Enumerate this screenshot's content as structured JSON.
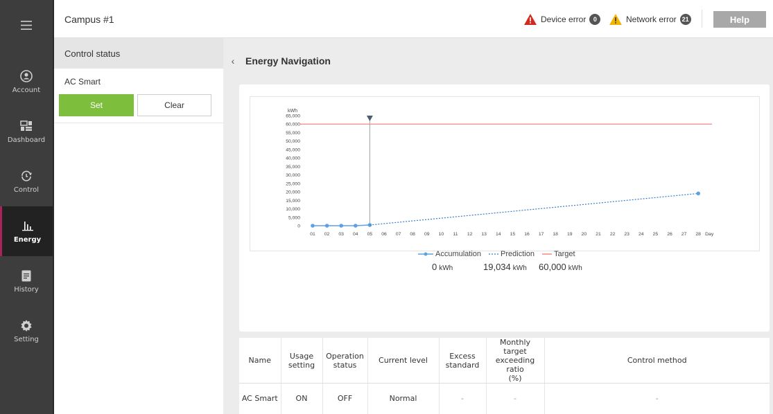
{
  "nav": {
    "menu_icon": "hamburger-icon",
    "items": [
      {
        "label": "Account",
        "icon": "account-icon"
      },
      {
        "label": "Dashboard",
        "icon": "dashboard-icon"
      },
      {
        "label": "Control",
        "icon": "control-icon"
      },
      {
        "label": "Energy",
        "icon": "energy-icon",
        "active": true
      },
      {
        "label": "History",
        "icon": "history-icon"
      },
      {
        "label": "Setting",
        "icon": "setting-icon"
      }
    ]
  },
  "header": {
    "title": "Campus #1",
    "device_error_label": "Device error",
    "device_error_count": "0",
    "network_error_label": "Network error",
    "network_error_count": "21",
    "help_label": "Help",
    "colors": {
      "device_error": "#d32a1f",
      "network_error": "#f2b600"
    }
  },
  "left_panel": {
    "header": "Control status",
    "item_name": "AC Smart",
    "set_label": "Set",
    "clear_label": "Clear"
  },
  "main": {
    "title": "Energy Navigation"
  },
  "chart_data": {
    "type": "line",
    "ylabel": "kWh",
    "xlabel": "Day",
    "ylim": [
      0,
      65000
    ],
    "yticks": [
      "65,000",
      "60,000",
      "55,000",
      "50,000",
      "45,000",
      "40,000",
      "35,000",
      "30,000",
      "25,000",
      "20,000",
      "15,000",
      "10,000",
      "5,000",
      "0"
    ],
    "x": [
      "01",
      "02",
      "03",
      "04",
      "05",
      "06",
      "07",
      "08",
      "09",
      "10",
      "11",
      "12",
      "13",
      "14",
      "15",
      "16",
      "17",
      "18",
      "19",
      "20",
      "21",
      "22",
      "23",
      "24",
      "25",
      "26",
      "27",
      "28"
    ],
    "current_day": "05",
    "series": [
      {
        "name": "Accumulation",
        "style": "solid-marker",
        "color": "#5aa2e0",
        "points": [
          {
            "x": "01",
            "y": 0
          },
          {
            "x": "02",
            "y": 0
          },
          {
            "x": "03",
            "y": 0
          },
          {
            "x": "04",
            "y": 0
          },
          {
            "x": "05",
            "y": 400
          }
        ]
      },
      {
        "name": "Prediction",
        "style": "dotted",
        "color": "#3a78c8",
        "points": [
          {
            "x": "05",
            "y": 400
          },
          {
            "x": "28",
            "y": 19034
          }
        ]
      },
      {
        "name": "Target",
        "style": "solid",
        "color": "#f08a80",
        "points": [
          {
            "x": "01",
            "y": 60000
          },
          {
            "x": "28",
            "y": 60000
          }
        ]
      }
    ],
    "legend": [
      {
        "name": "Accumulation",
        "value": "0",
        "unit": "kWh"
      },
      {
        "name": "Prediction",
        "value": "19,034",
        "unit": "kWh"
      },
      {
        "name": "Target",
        "value": "60,000",
        "unit": "kWh"
      }
    ]
  },
  "table": {
    "headers": [
      "Name",
      "Usage\nsetting",
      "Operation\nstatus",
      "Current level",
      "Excess\nstandard",
      "Monthly target\nexceeding ratio\n(%)",
      "Control method"
    ],
    "rows": [
      [
        "AC Smart",
        "ON",
        "OFF",
        "Normal",
        "-",
        "-",
        "-"
      ]
    ]
  }
}
